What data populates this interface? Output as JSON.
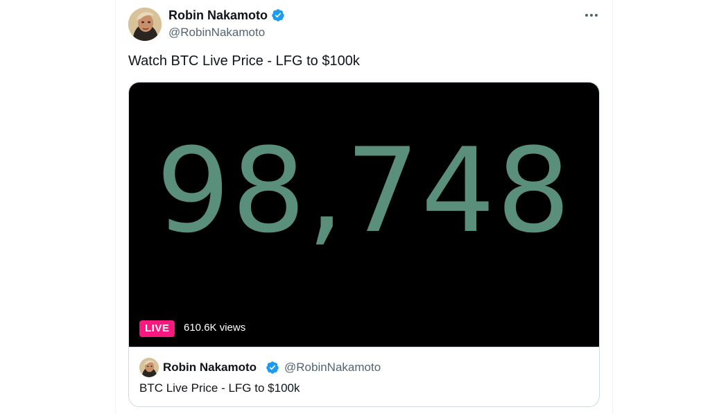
{
  "post": {
    "author_name": "Robin Nakamoto",
    "author_handle": "@RobinNakamoto",
    "verified": true,
    "text": "Watch BTC Live Price - LFG to $100k",
    "more_icon": "more-horizontal-icon"
  },
  "broadcast": {
    "price": "98,748",
    "live_label": "LIVE",
    "views": "610.6K views",
    "card_author_name": "Robin Nakamoto",
    "card_author_handle": "@RobinNakamoto",
    "card_title": "BTC Live Price - LFG to $100k"
  },
  "colors": {
    "price": "#5a8f7b",
    "live_badge": "#f91880",
    "verified": "#1d9bf0",
    "handle": "#536471"
  }
}
